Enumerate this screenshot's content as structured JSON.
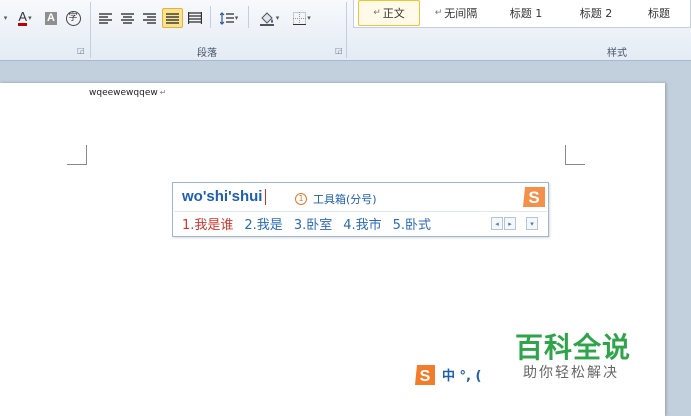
{
  "ribbon": {
    "paragraph_group_label": "段落",
    "styles_group_label": "样式",
    "styles": [
      {
        "label": "正文",
        "marker": "↵",
        "selected": true
      },
      {
        "label": "无间隔",
        "marker": "↵",
        "selected": false
      },
      {
        "label": "标题 1",
        "marker": "",
        "selected": false
      },
      {
        "label": "标题 2",
        "marker": "",
        "selected": false
      },
      {
        "label": "标题",
        "marker": "",
        "selected": false
      }
    ],
    "font_color_label": "A",
    "char_shading_label": "A",
    "phonetic_guide_label": "字",
    "accent_color": "#c00000"
  },
  "document": {
    "text": "wqeewewqqew",
    "return_mark": "↵"
  },
  "ime": {
    "pinyin": "wo'shi'shui",
    "hint": "工具箱(分号)",
    "hint_icon": "1",
    "candidates": [
      "1.我是谁",
      "2.我是",
      "3.卧室",
      "4.我市",
      "5.卧式"
    ],
    "nav_prev": "◂",
    "nav_next": "▸",
    "nav_more": "▾",
    "logo": "sogou-logo"
  },
  "ime_status": {
    "text": "中 °, ("
  },
  "watermark": {
    "title": "百科全说",
    "subtitle": "助你轻松解决"
  }
}
